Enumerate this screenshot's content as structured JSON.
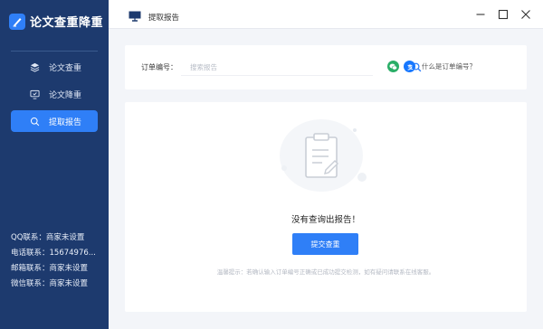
{
  "app": {
    "name": "论文查重降重"
  },
  "sidebar": {
    "items": [
      {
        "label": "论文查重",
        "active": false
      },
      {
        "label": "论文降重",
        "active": false
      },
      {
        "label": "提取报告",
        "active": true
      }
    ],
    "contacts": [
      {
        "text": "QQ联系：商家未设置"
      },
      {
        "text": "电话联系：15674976..."
      },
      {
        "text": "邮箱联系：商家未设置"
      },
      {
        "text": "微信联系：商家未设置"
      }
    ]
  },
  "header": {
    "title": "提取报告"
  },
  "search": {
    "label": "订单编号：",
    "placeholder": "搜索报告",
    "help_text": "什么是订单编号？"
  },
  "result": {
    "empty_text": "没有查询出报告！",
    "submit_label": "提交查重",
    "hint": "温馨提示：若确认输入订单编号正确或已成功提交检测，如有疑问请联系在线客服。"
  },
  "colors": {
    "sidebar_bg": "#1d3a6e",
    "accent": "#2f7ff7",
    "wechat": "#2aae67",
    "alipay": "#1677ff"
  }
}
